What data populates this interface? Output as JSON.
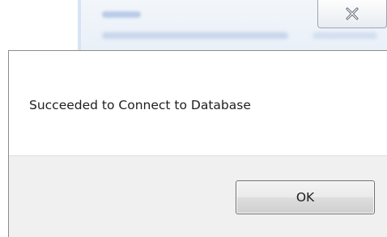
{
  "dialog": {
    "message": "Succeeded to Connect to Database",
    "ok_label": "OK"
  },
  "background_window": {
    "close_icon": "close-icon"
  },
  "colors": {
    "footer_bg": "#f0f0f0",
    "text": "#1e1e1e",
    "button_border": "#707070"
  }
}
